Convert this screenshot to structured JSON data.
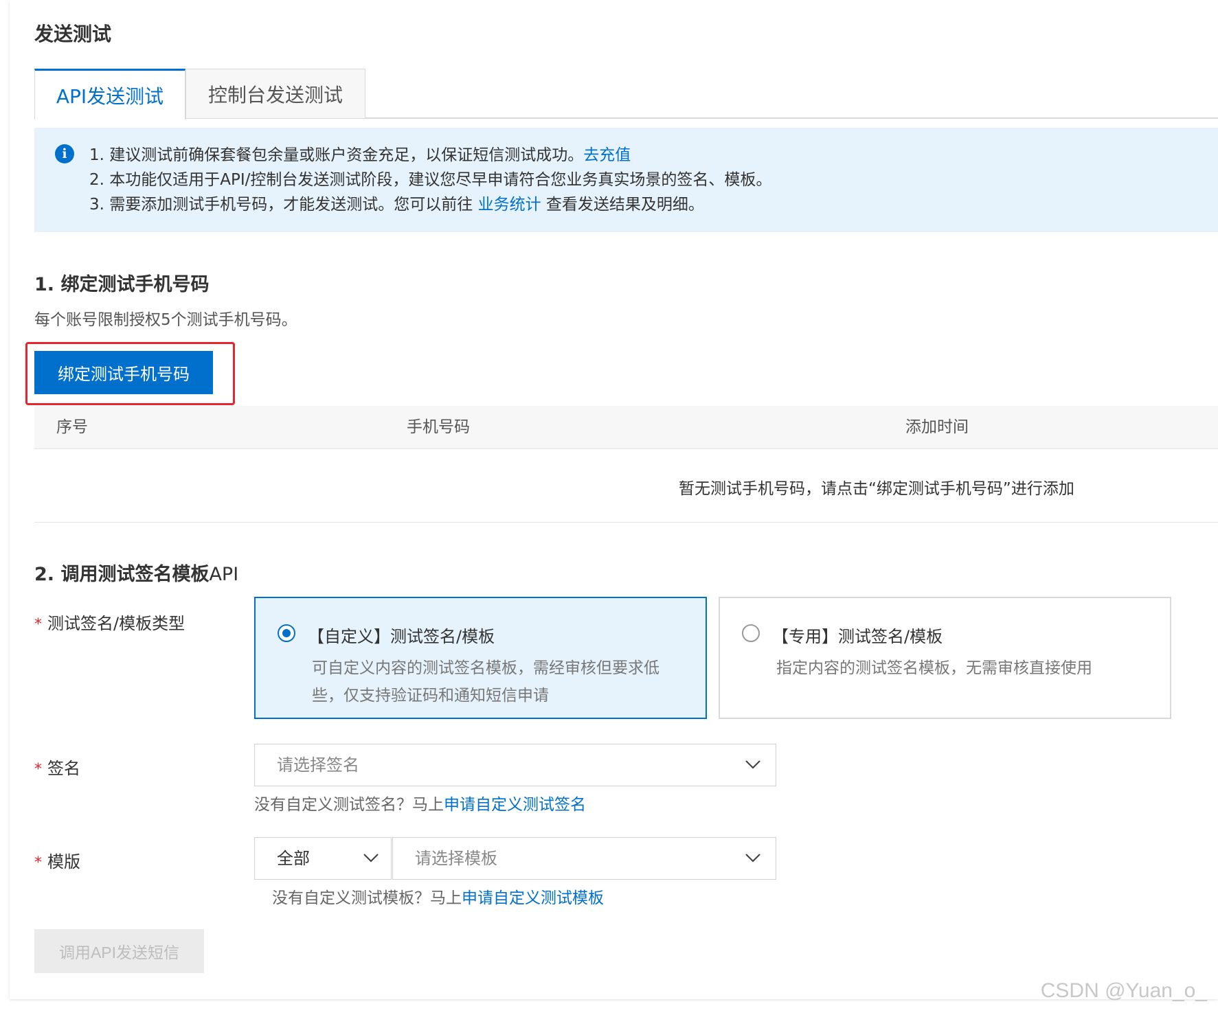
{
  "page": {
    "title": "发送测试"
  },
  "tabs": [
    {
      "label": "API发送测试",
      "active": true
    },
    {
      "label": "控制台发送测试",
      "active": false
    }
  ],
  "notice": {
    "line1": "1. 建议测试前确保套餐包余量或账户资金充足，以保证短信测试成功。",
    "line1_link": "去充值",
    "line2": "2. 本功能仅适用于API/控制台发送测试阶段，建议您尽早申请符合您业务真实场景的签名、模板。",
    "line3_before": "3. 需要添加测试手机号码，才能发送测试。您可以前往 ",
    "line3_link": "业务统计",
    "line3_after": " 查看发送结果及明细。"
  },
  "section1": {
    "title": "1. 绑定测试手机号码",
    "desc": "每个账号限制授权5个测试手机号码。",
    "button": "绑定测试手机号码",
    "columns": [
      "序号",
      "手机号码",
      "添加时间"
    ],
    "empty": "暂无测试手机号码，请点击“绑定测试手机号码”进行添加"
  },
  "section2": {
    "title_bold": "2. 调用测试签名模板",
    "title_rest": "API",
    "required_mark": "*",
    "type_label": "测试签名/模板类型",
    "types": [
      {
        "title": "【自定义】测试签名/模板",
        "desc": "可自定义内容的测试签名模板，需经审核但要求低些，仅支持验证码和通知短信申请",
        "selected": true
      },
      {
        "title": "【专用】测试签名/模板",
        "desc": "指定内容的测试签名模板，无需审核直接使用",
        "selected": false
      }
    ],
    "sign_label": "签名",
    "sign_placeholder": "请选择签名",
    "sign_help": "没有自定义测试签名？马上",
    "sign_help_link": "申请自定义测试签名",
    "template_label": "模版",
    "template_filter_value": "全部",
    "template_placeholder": "请选择模板",
    "template_help": "没有自定义测试模板？马上",
    "template_help_link": "申请自定义测试模板",
    "submit": "调用API发送短信"
  },
  "watermark": "CSDN @Yuan_o_",
  "colors": {
    "primary": "#0070cc",
    "notice_bg": "#e6f3fc",
    "highlight_red": "#e6262f"
  },
  "icons": [
    "info-icon",
    "chevron-down-icon"
  ]
}
